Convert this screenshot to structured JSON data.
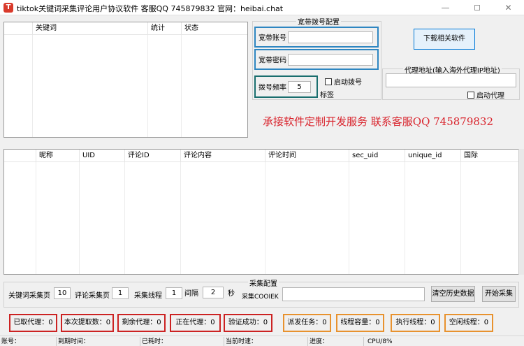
{
  "window": {
    "title": "tiktok关键词采集评论用户协议软件 客服QQ 745879832 官网：heibai.chat",
    "icon_glyph": "T",
    "minimize_glyph": "—",
    "close_glyph": "✕"
  },
  "keyword_list": {
    "columns": [
      "关键词",
      "统计",
      "状态"
    ]
  },
  "dial_config": {
    "title": "宽带拨号配置",
    "account_label": "宽带账号",
    "account_value": "",
    "password_label": "宽带密码",
    "password_value": "",
    "frequency_label": "拨号频率",
    "frequency_value": "5",
    "auto_dial_label": "启动拨号",
    "tag_label": "标签"
  },
  "download_button": "下载相关软件",
  "proxy": {
    "title": "代理地址(输入海外代理IP地址)",
    "value": "",
    "enable_label": "启动代理"
  },
  "promo_text": "承接软件定制开发服务 联系客服QQ 745879832",
  "data_list": {
    "columns": [
      "昵称",
      "UID",
      "评论ID",
      "评论内容",
      "评论时间",
      "sec_uid",
      "unique_id",
      "国际"
    ]
  },
  "collect_config": {
    "title": "采集配置",
    "keyword_pages_label": "关键词采集页",
    "keyword_pages_value": "10",
    "comment_pages_label": "评论采集页",
    "comment_pages_value": "1",
    "threads_label": "采集线程",
    "threads_value": "1",
    "interval_label": "间隔",
    "interval_value": "2",
    "seconds_label": "秒",
    "cookie_label": "采集COOIEK",
    "cookie_value": "",
    "clear_history_button": "清空历史数据",
    "start_button": "开始采集"
  },
  "stats": {
    "proxies_taken": "已取代理：0",
    "current_extract": "本次提取数：0",
    "remaining_proxies": "剩余代理：0",
    "proxies_in_use": "正在代理：0",
    "verified_ok": "验证成功：0",
    "tasks_dispatched": "派发任务：0",
    "thread_capacity": "线程容量：0",
    "running_threads": "执行线程：0",
    "idle_threads": "空闲线程：0"
  },
  "statusbar": {
    "account": "账号：",
    "expiry": "到期时间：",
    "elapsed": "已耗时：",
    "current_time": "当前时速：",
    "progress": "进度：",
    "cpu": "CPU/8%"
  },
  "colors": {
    "stat_red": "#cc2222",
    "stat_orange": "#e8922e",
    "promo_red": "#d9232c",
    "field_blue": "#2e86c1",
    "field_teal": "#1a6e6e"
  }
}
